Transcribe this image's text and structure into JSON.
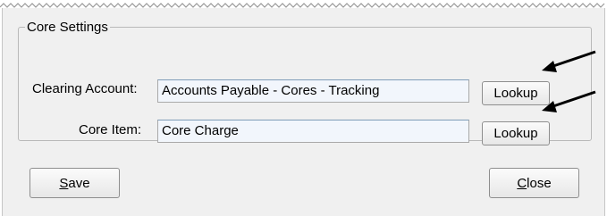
{
  "core_settings": {
    "legend": "Core Settings",
    "clearing_account": {
      "label": "Clearing Account:",
      "value": "Accounts Payable - Cores - Tracking",
      "lookup_label": "Lookup"
    },
    "core_item": {
      "label": "Core Item:",
      "value": "Core Charge",
      "lookup_label": "Lookup"
    }
  },
  "footer": {
    "save": {
      "mnemonic": "S",
      "rest": "ave"
    },
    "close": {
      "mnemonic": "C",
      "rest": "lose"
    }
  },
  "icons": {
    "callout_arrow": "arrow-pointing-left-icon"
  }
}
